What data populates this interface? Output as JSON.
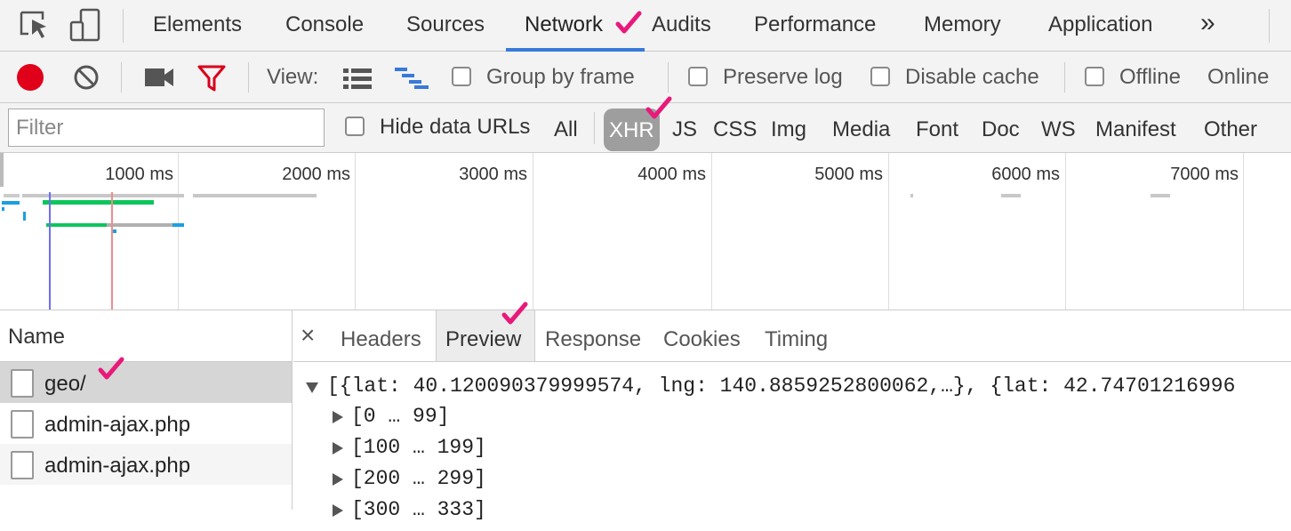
{
  "tabbar": {
    "tabs": [
      "Elements",
      "Console",
      "Sources",
      "Network",
      "Audits",
      "Performance",
      "Memory",
      "Application"
    ],
    "active_tab": "Network",
    "more_label": "»"
  },
  "toolbar": {
    "view_label": "View:",
    "group_by_frame_label": "Group by frame",
    "preserve_log_label": "Preserve log",
    "disable_cache_label": "Disable cache",
    "offline_label": "Offline",
    "online_label": "Online",
    "record_color": "#e0001a",
    "filter_icon_color": "#d9001b"
  },
  "filterbar": {
    "filter_placeholder": "Filter",
    "hide_data_urls_label": "Hide data URLs",
    "types": [
      "All",
      "XHR",
      "JS",
      "CSS",
      "Img",
      "Media",
      "Font",
      "Doc",
      "WS",
      "Manifest",
      "Other"
    ],
    "selected_type": "XHR"
  },
  "overview": {
    "ticks": [
      "1000 ms",
      "2000 ms",
      "3000 ms",
      "4000 ms",
      "5000 ms",
      "6000 ms",
      "7000 ms"
    ],
    "dom_content_loaded_color": "#6e6ef0",
    "load_color": "#ef8d8d"
  },
  "requests": {
    "header": "Name",
    "rows": [
      "geo/",
      "admin-ajax.php",
      "admin-ajax.php"
    ]
  },
  "detail": {
    "close_label": "×",
    "tabs": [
      "Headers",
      "Preview",
      "Response",
      "Cookies",
      "Timing"
    ],
    "active_tab": "Preview"
  },
  "preview": {
    "root": "[{lat: 40.120090379999574, lng: 140.8859252800062,…}, {lat: 42.74701216996",
    "groups": [
      "[0 … 99]",
      "[100 … 199]",
      "[200 … 299]",
      "[300 … 333]"
    ]
  },
  "annotation_color": "#e8197a"
}
